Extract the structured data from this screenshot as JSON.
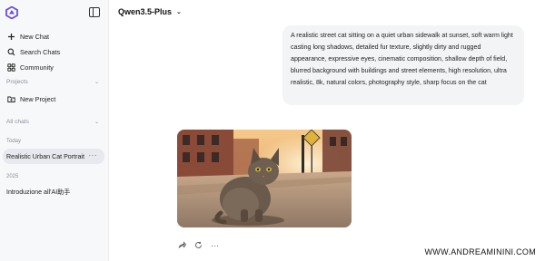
{
  "sidebar": {
    "nav": [
      {
        "label": "New Chat",
        "icon": "plus-icon"
      },
      {
        "label": "Search Chats",
        "icon": "search-icon"
      },
      {
        "label": "Community",
        "icon": "grid-icon"
      }
    ],
    "projects_label": "Projects",
    "new_project": "New Project",
    "all_chats_label": "All chats",
    "group_today": "Today",
    "today_chat": "Realistic Urban Cat Portrait",
    "group_2025": "2025",
    "older_chat": "Introduzione all'AI助手"
  },
  "header": {
    "model": "Qwen3.5-Plus"
  },
  "conversation": {
    "prompt": "A realistic street cat sitting on a quiet urban sidewalk at sunset, soft warm light casting long shadows, detailed fur texture, slightly dirty and rugged appearance, expressive eyes, cinematic composition, shallow depth of field, blurred background with buildings and street elements, high resolution, ultra realistic, 8k, natural colors, photography style, sharp focus on the cat"
  },
  "watermark": "WWW.ANDREAMININI.COM",
  "colors": {
    "sidebar_bg": "#f7f8fa",
    "active_item": "#e7e9ee",
    "bubble_bg": "#f3f4f6",
    "logo": "#6b4ce6"
  }
}
